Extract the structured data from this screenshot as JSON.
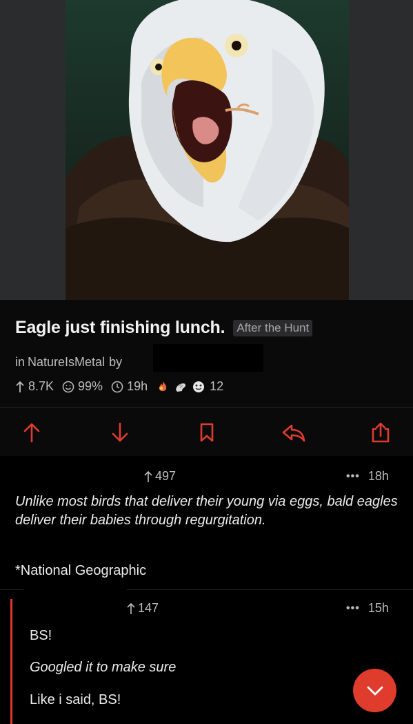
{
  "post": {
    "title": "Eagle just finishing lunch.",
    "flair": "After the Hunt",
    "in_label": "in",
    "subreddit": "NatureIsMetal",
    "by_label": "by",
    "upvotes": "8.7K",
    "upvote_ratio": "99%",
    "age": "19h",
    "award_count": "12",
    "image_icon": "eagle-photo"
  },
  "actions": {
    "icons": [
      "upvote-icon",
      "downvote-icon",
      "bookmark-icon",
      "reply-icon",
      "share-icon"
    ]
  },
  "comments": [
    {
      "score": "497",
      "age": "18h",
      "body_italic": "Unlike most birds that deliver their young via eggs, bald eagles deliver their babies through regurgitation.",
      "body_plain": "*National Geographic"
    },
    {
      "score": "147",
      "age": "15h",
      "line1": "BS!",
      "line2": "Googled it to make sure",
      "line3": "Like i said, BS!"
    }
  ],
  "colors": {
    "accent": "#e03c2e",
    "background": "#000000",
    "text": "#e6e6e6",
    "muted": "#bdbdbd"
  }
}
